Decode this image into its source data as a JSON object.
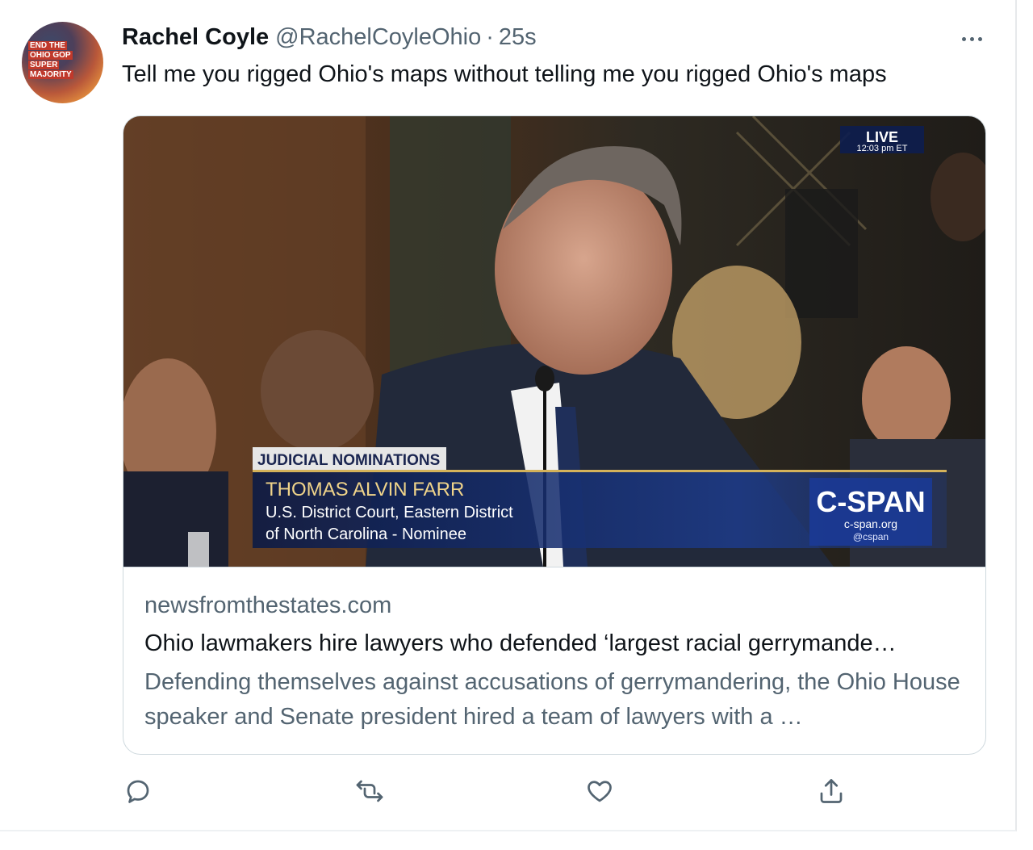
{
  "tweet": {
    "author_name": "Rachel Coyle",
    "handle": "@RachelCoyleOhio",
    "separator": "·",
    "time": "25s",
    "text": "Tell me you rigged Ohio's maps without telling me you rigged Ohio's maps"
  },
  "avatar": {
    "lines": [
      "END THE",
      "OHIO GOP",
      "SUPER",
      "MAJORITY"
    ]
  },
  "media": {
    "live_label": "LIVE",
    "live_time": "12:03 pm ET",
    "chyron_category": "JUDICIAL NOMINATIONS",
    "chyron_name": "THOMAS ALVIN FARR",
    "chyron_line1": "U.S. District Court, Eastern District",
    "chyron_line2": "of North Carolina - Nominee",
    "network_logo": "C-SPAN",
    "network_url": "c-span.org",
    "network_handle": "@cspan"
  },
  "card": {
    "domain": "newsfromthestates.com",
    "title": "Ohio lawmakers hire lawyers who defended ‘largest racial gerrymande…",
    "description": "Defending themselves against accusations of gerrymandering, the Ohio House speaker and Senate president hired a team of lawyers with a …"
  },
  "actions": {
    "reply_icon": "reply-icon",
    "retweet_icon": "retweet-icon",
    "like_icon": "like-icon",
    "share_icon": "share-icon"
  },
  "colors": {
    "text_primary": "#0f1419",
    "text_secondary": "#536471",
    "border": "#cfd9de"
  }
}
